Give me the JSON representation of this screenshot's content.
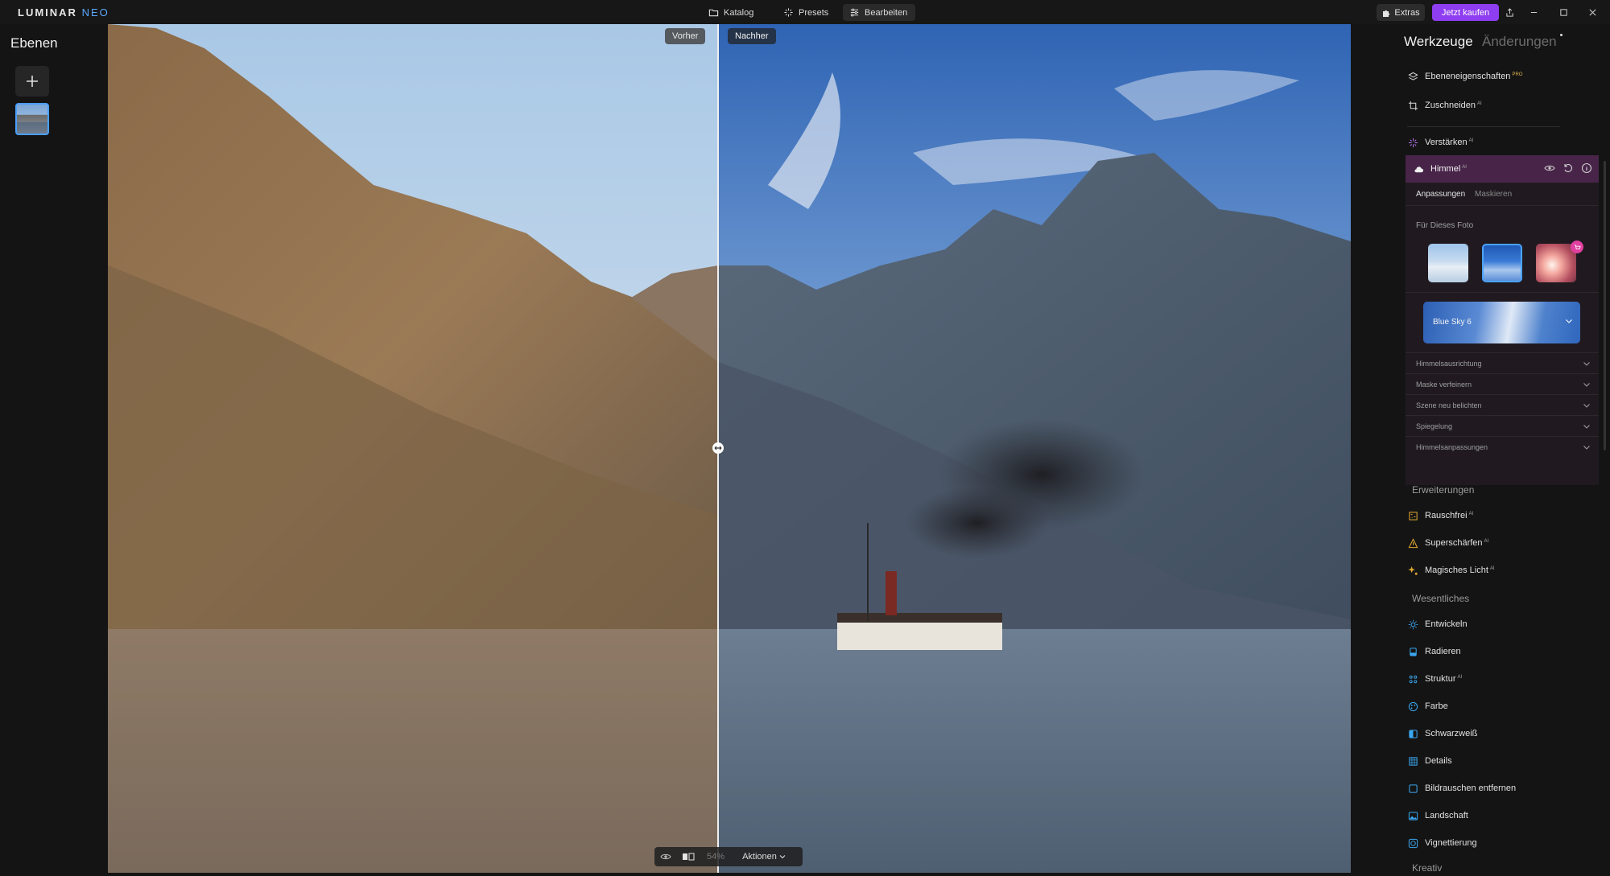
{
  "app": {
    "logo_main": "LUMINAR",
    "logo_suffix": "NEO"
  },
  "topnav": {
    "catalog": "Katalog",
    "presets": "Presets",
    "edit": "Bearbeiten",
    "extras": "Extras",
    "buy": "Jetzt kaufen",
    "accent_color": "#8e3df0"
  },
  "layers": {
    "title": "Ebenen"
  },
  "canvas": {
    "before_label": "Vorher",
    "after_label": "Nachher",
    "zoom": "54%",
    "actions": "Aktionen"
  },
  "right_panel": {
    "tab_tools": "Werkzeuge",
    "tab_changes": "Änderungen",
    "tools_top": [
      {
        "label": "Ebeneneigenschaften",
        "badge": "PRO",
        "icon": "layers-icon"
      },
      {
        "label": "Zuschneiden",
        "badge": "AI",
        "icon": "crop-icon"
      },
      {
        "label": "Verstärken",
        "badge": "AI",
        "icon": "enhance-icon"
      }
    ],
    "sky": {
      "label": "Himmel",
      "badge": "AI",
      "subtab_adjust": "Anpassungen",
      "subtab_mask": "Maskieren",
      "for_photo": "Für Dieses Foto",
      "selected_sky": "Blue Sky 6",
      "accordions": [
        "Himmelsausrichtung",
        "Maske verfeinern",
        "Szene neu belichten",
        "Spiegelung",
        "Himmelsanpassungen"
      ]
    },
    "sections": {
      "extensions": "Erweiterungen",
      "essentials": "Wesentliches",
      "creative": "Kreativ"
    },
    "extensions": [
      {
        "label": "Rauschfrei",
        "badge": "AI"
      },
      {
        "label": "Superschärfen",
        "badge": "AI"
      },
      {
        "label": "Magisches Licht",
        "badge": "AI"
      }
    ],
    "essentials": [
      {
        "label": "Entwickeln",
        "badge": ""
      },
      {
        "label": "Radieren",
        "badge": ""
      },
      {
        "label": "Struktur",
        "badge": "AI"
      },
      {
        "label": "Farbe",
        "badge": ""
      },
      {
        "label": "Schwarzweiß",
        "badge": ""
      },
      {
        "label": "Details",
        "badge": ""
      },
      {
        "label": "Bildrauschen entfernen",
        "badge": ""
      },
      {
        "label": "Landschaft",
        "badge": ""
      },
      {
        "label": "Vignettierung",
        "badge": ""
      }
    ]
  }
}
